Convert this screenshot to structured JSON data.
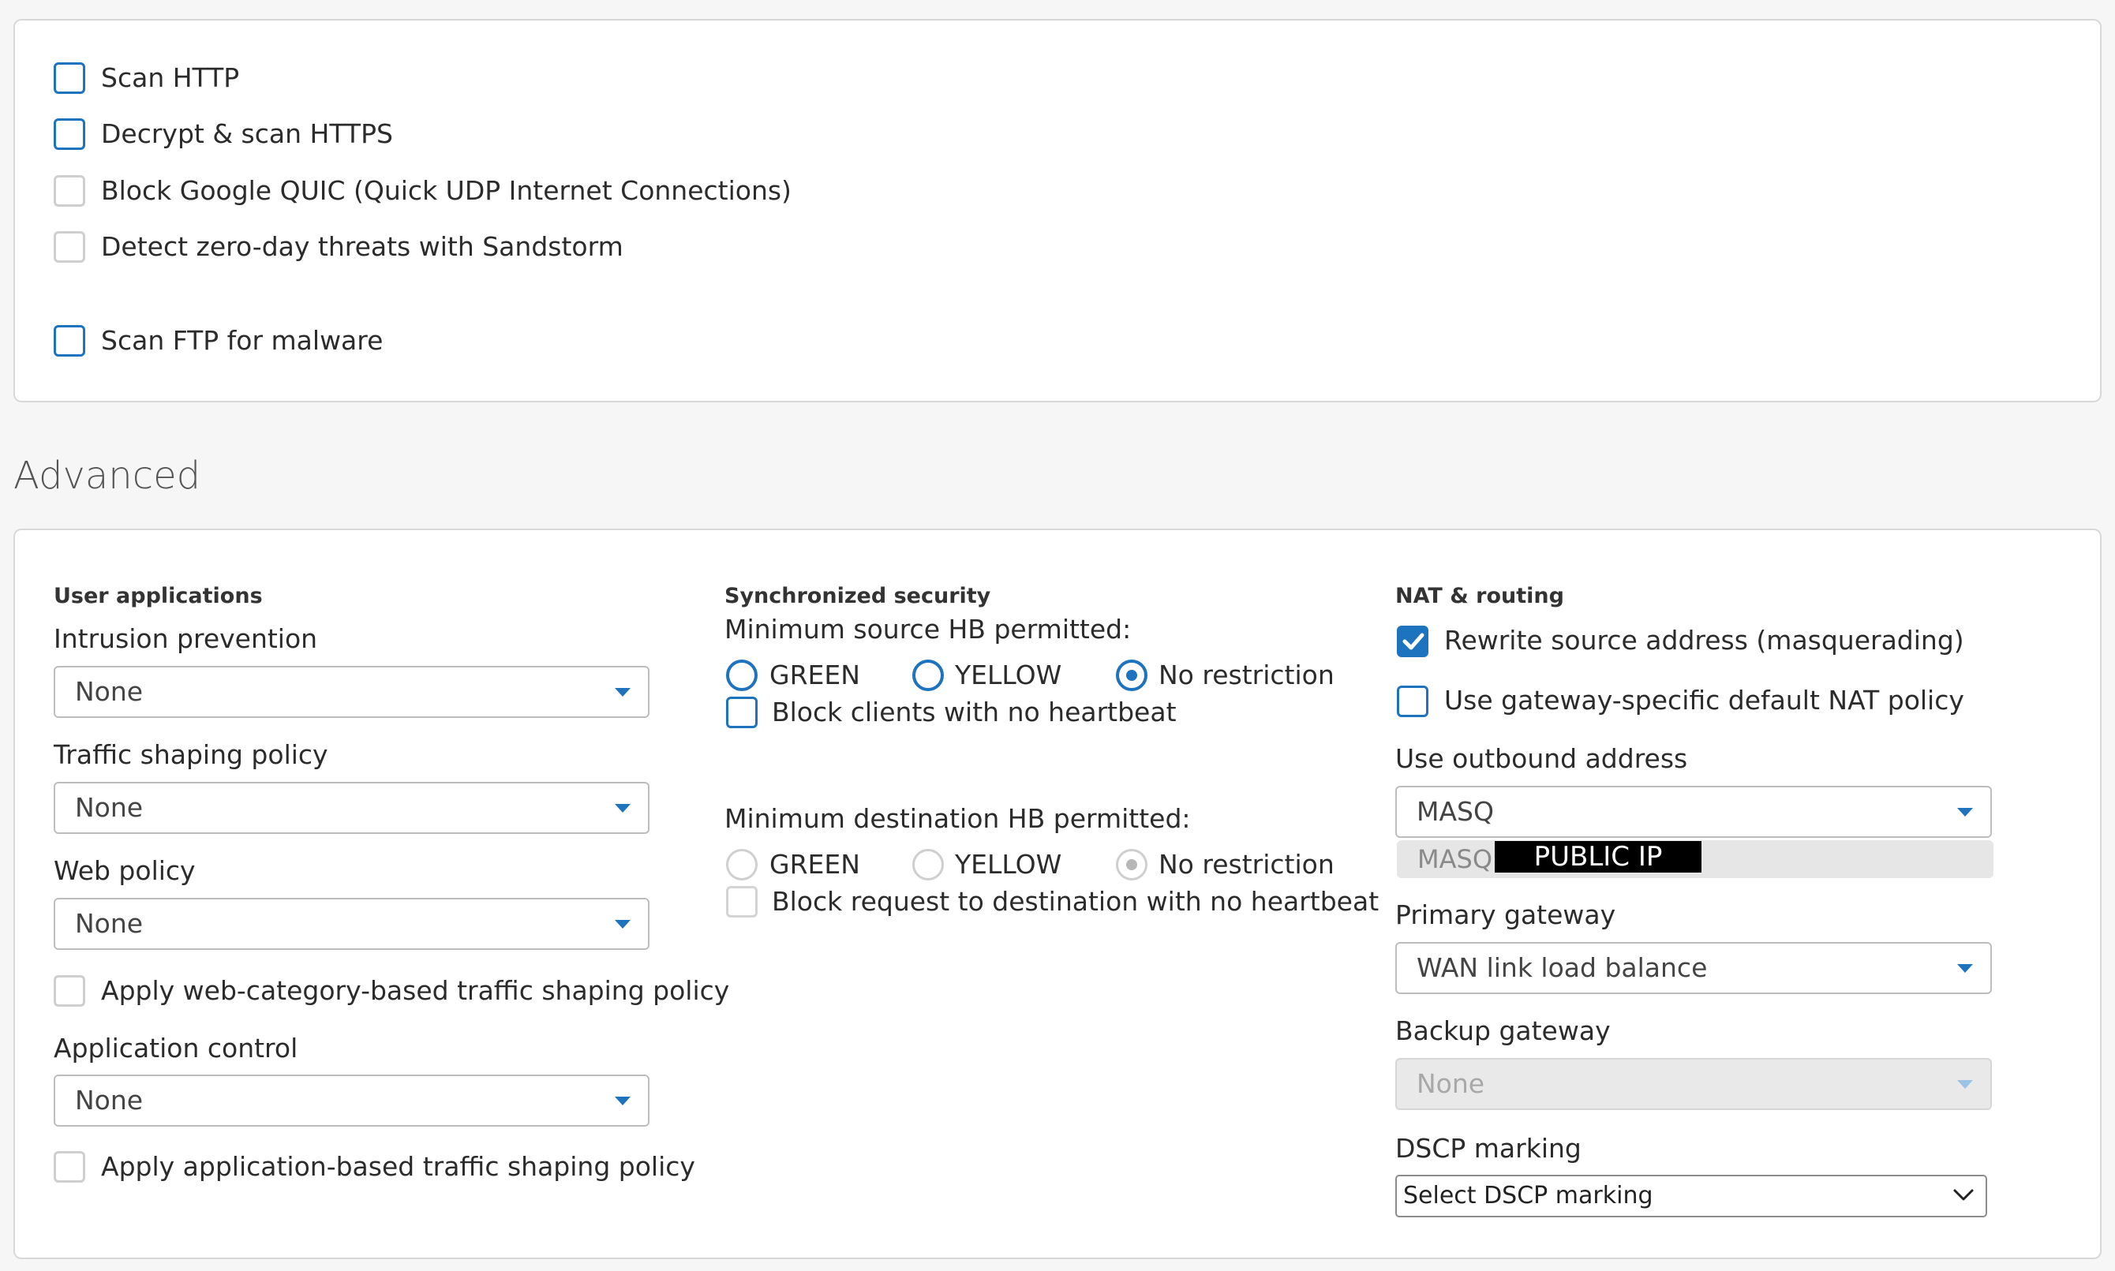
{
  "scanning": {
    "items": [
      {
        "label": "Scan HTTP",
        "checked": false
      },
      {
        "label": "Decrypt & scan HTTPS",
        "checked": false
      },
      {
        "label": "Block Google QUIC (Quick UDP Internet Connections)",
        "checked": false
      },
      {
        "label": "Detect zero-day threats with Sandstorm",
        "checked": false
      },
      {
        "label": "Scan FTP for malware",
        "checked": false
      }
    ]
  },
  "advanced": {
    "title": "Advanced",
    "user_apps": {
      "heading": "User applications",
      "intrusion_label": "Intrusion prevention",
      "intrusion_value": "None",
      "traffic_label": "Traffic shaping policy",
      "traffic_value": "None",
      "web_label": "Web policy",
      "web_value": "None",
      "web_category_cb": "Apply web-category-based traffic shaping policy",
      "app_control_label": "Application control",
      "app_control_value": "None",
      "app_based_cb": "Apply application-based traffic shaping policy"
    },
    "sync": {
      "heading": "Synchronized security",
      "min_source_label": "Minimum source HB permitted:",
      "min_dest_label": "Minimum destination HB permitted:",
      "opt_green": "GREEN",
      "opt_yellow": "YELLOW",
      "opt_none": "No restriction",
      "block_clients": "Block clients with no heartbeat",
      "block_request": "Block request to destination with no heartbeat"
    },
    "nat": {
      "heading": "NAT & routing",
      "rewrite_source": "Rewrite source address (masquerading)",
      "gateway_default": "Use gateway-specific default NAT policy",
      "outbound_label": "Use outbound address",
      "outbound_value": "MASQ",
      "outbound_option": "MASQ",
      "redacted": "PUBLIC IP",
      "primary_label": "Primary gateway",
      "primary_value": "WAN link load balance",
      "backup_label": "Backup gateway",
      "backup_value": "None",
      "dscp_label": "DSCP marking",
      "dscp_value": "Select DSCP marking"
    }
  },
  "colors": {
    "accent": "#1e73be",
    "border": "#d8d8d8"
  }
}
